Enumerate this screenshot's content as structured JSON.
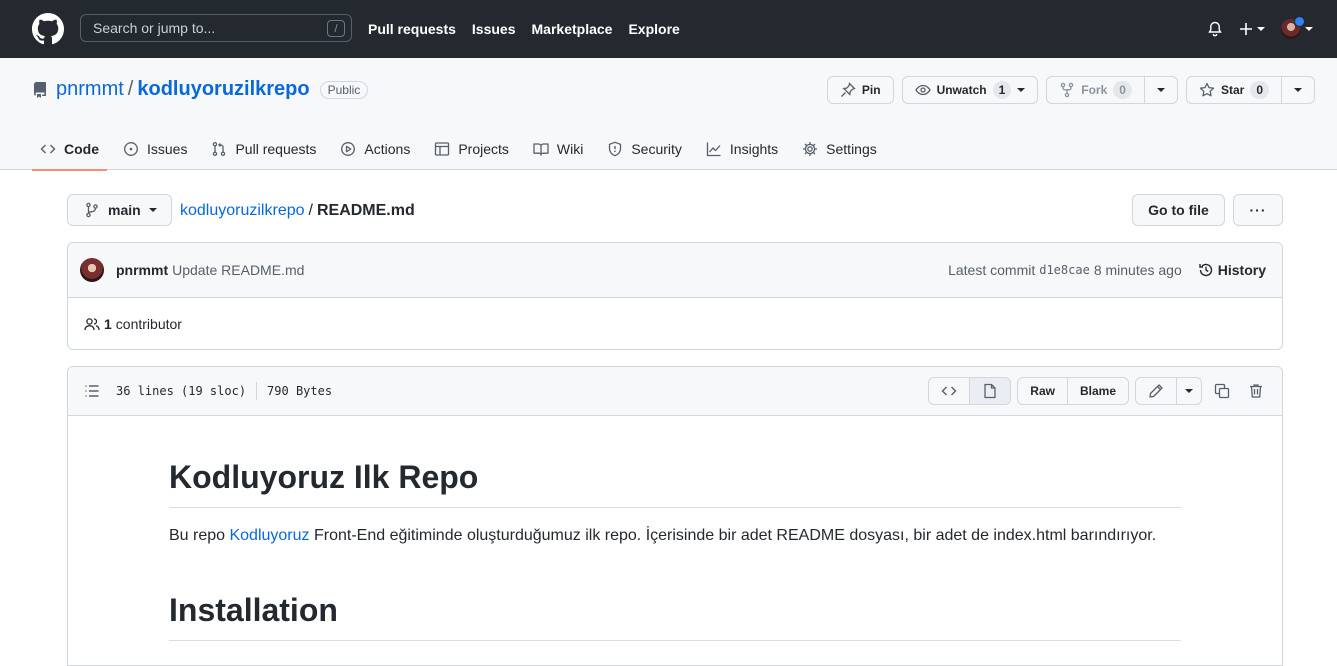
{
  "header": {
    "search_placeholder": "Search or jump to...",
    "search_shortcut": "/",
    "nav": [
      "Pull requests",
      "Issues",
      "Marketplace",
      "Explore"
    ]
  },
  "repo": {
    "owner": "pnrmmt",
    "separator": "/",
    "name": "kodluyoruzilkrepo",
    "visibility": "Public",
    "pin_label": "Pin",
    "unwatch_label": "Unwatch",
    "watch_count": "1",
    "fork_label": "Fork",
    "fork_count": "0",
    "star_label": "Star",
    "star_count": "0"
  },
  "tabs": [
    "Code",
    "Issues",
    "Pull requests",
    "Actions",
    "Projects",
    "Wiki",
    "Security",
    "Insights",
    "Settings"
  ],
  "file_nav": {
    "branch": "main",
    "repo_crumb": "kodluyoruzilkrepo",
    "crumb_sep": "/",
    "file_name": "README.md",
    "goto_label": "Go to file",
    "more_label": "···"
  },
  "commit": {
    "author": "pnrmmt",
    "message": "Update README.md",
    "latest_label": "Latest commit",
    "sha": "d1e8cae",
    "time": "8 minutes ago",
    "history_label": "History",
    "contributors_count": "1",
    "contributors_label": "contributor"
  },
  "file": {
    "lines": "36 lines (19 sloc)",
    "size": "790 Bytes",
    "raw_label": "Raw",
    "blame_label": "Blame"
  },
  "readme": {
    "h1": "Kodluyoruz Ilk Repo",
    "p_before": "Bu repo ",
    "p_link": "Kodluyoruz",
    "p_after": " Front-End eğitiminde oluşturduğumuz ilk repo. İçerisinde bir adet README dosyası, bir adet de index.html barındırıyor.",
    "h2": "Installation"
  },
  "colors": {
    "header_bg": "#24292f",
    "link": "#0969da",
    "active_tab_underline": "#fd8c73",
    "notification_dot": "#2f81f7"
  }
}
